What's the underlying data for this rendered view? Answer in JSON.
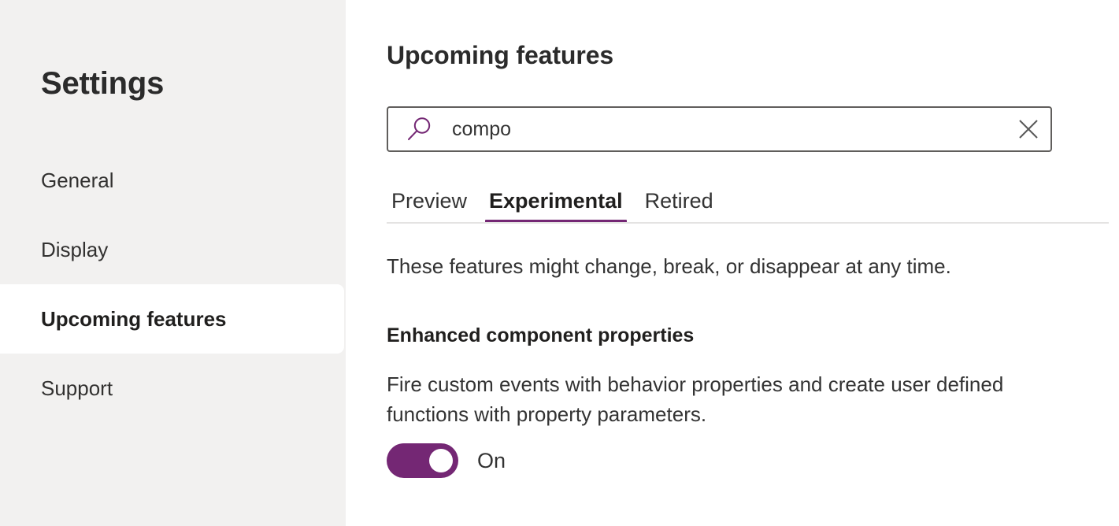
{
  "sidebar": {
    "title": "Settings",
    "items": [
      {
        "label": "General",
        "selected": false
      },
      {
        "label": "Display",
        "selected": false
      },
      {
        "label": "Upcoming features",
        "selected": true
      },
      {
        "label": "Support",
        "selected": false
      }
    ]
  },
  "main": {
    "page_title": "Upcoming features",
    "search": {
      "value": "compo",
      "placeholder": "Search",
      "search_icon": "search-icon",
      "clear_icon": "close-icon"
    },
    "tabs": [
      {
        "label": "Preview",
        "active": false
      },
      {
        "label": "Experimental",
        "active": true
      },
      {
        "label": "Retired",
        "active": false
      }
    ],
    "tab_description": "These features might change, break, or disappear at any time.",
    "feature": {
      "name": "Enhanced component properties",
      "description": "Fire custom events with behavior properties and create user defined functions with property parameters.",
      "toggle_state": "On"
    }
  },
  "colors": {
    "accent": "#742774",
    "sidebar_bg": "#f2f1f0",
    "selected_bg": "#ffffff",
    "text": "#333333",
    "heading": "#2b2b2b",
    "border": "#605e5c",
    "divider": "#e4e3e2"
  }
}
